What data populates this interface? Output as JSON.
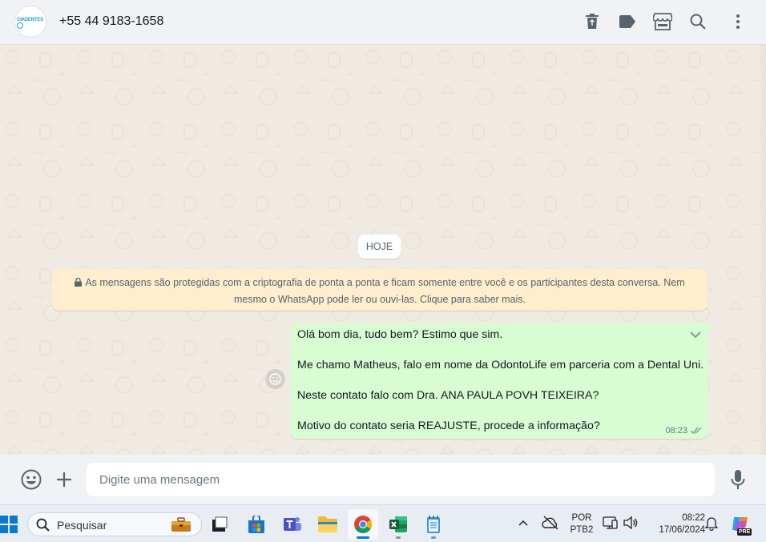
{
  "header": {
    "avatar_text": "CIADENTES",
    "contact_name": "+55 44 9183-1658",
    "icons": [
      "trash-icon",
      "label-icon",
      "store-icon",
      "search-icon",
      "menu-icon"
    ]
  },
  "chat": {
    "date_chip": "HOJE",
    "encryption_notice": "As mensagens são protegidas com a criptografia de ponta a ponta e ficam somente entre você e os participantes desta conversa. Nem mesmo o WhatsApp pode ler ou ouvi-las. Clique para saber mais.",
    "message": {
      "lines": [
        "Olá bom dia, tudo bem? Estimo que sim.",
        "Me chamo Matheus, falo em nome da OdontoLife em parceria com a Dental Uni.",
        "Neste contato falo com Dra. ANA PAULA POVH TEIXEIRA?",
        "Motivo do contato seria REAJUSTE, procede a informação?"
      ],
      "time": "08:23",
      "status": "read"
    }
  },
  "composer": {
    "placeholder": "Digite uma mensagem"
  },
  "taskbar": {
    "search_placeholder": "Pesquisar",
    "language": "POR",
    "keyboard": "PTB2",
    "time": "08:22",
    "date": "17/06/2024",
    "copilot_badge": "PRE"
  },
  "colors": {
    "chat_bg": "#efeae2",
    "outgoing_bubble": "#d9fdd3",
    "notice_bg": "#ffeecd",
    "header_bg": "#f0f2f5",
    "taskbar_bg": "#e8edf4",
    "accent_blue": "#0a78d4"
  }
}
